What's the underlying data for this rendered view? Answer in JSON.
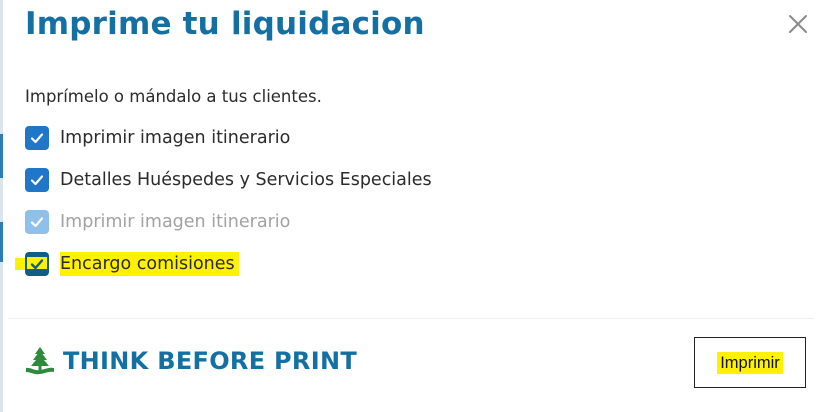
{
  "modal": {
    "title": "Imprime tu liquidacion",
    "subtitle": "Imprímelo o mándalo a tus clientes."
  },
  "options": [
    {
      "label": "Imprimir imagen itinerario",
      "checked": true,
      "disabled": false,
      "highlighted": false
    },
    {
      "label": "Detalles Huéspedes y Servicios Especiales",
      "checked": true,
      "disabled": false,
      "highlighted": false
    },
    {
      "label": "Imprimir imagen itinerario",
      "checked": true,
      "disabled": true,
      "highlighted": false
    },
    {
      "label": "Encargo comisiones",
      "checked": true,
      "disabled": false,
      "highlighted": true
    }
  ],
  "footer": {
    "think_text": "THINK BEFORE PRINT",
    "think_icon": "tree-icon",
    "print_label": "Imprimir"
  },
  "icons": {
    "close": "close-icon",
    "check": "check-icon"
  },
  "colors": {
    "title": "#1470a3",
    "checkbox": "#2077c8",
    "checkbox_disabled": "#8ec0ea",
    "highlight": "#fff200",
    "think_green": "#2e8b3e"
  }
}
